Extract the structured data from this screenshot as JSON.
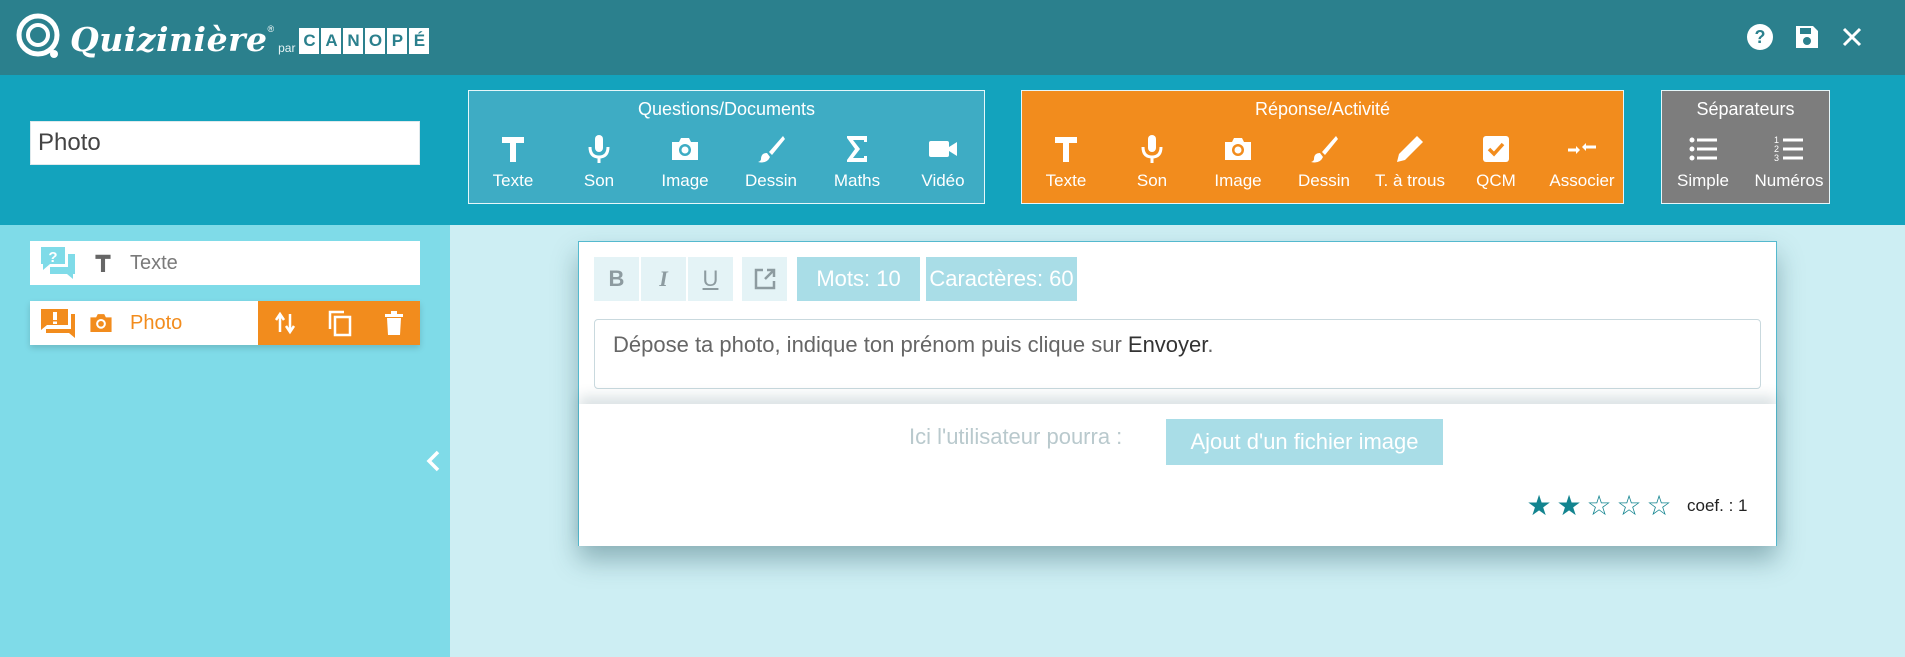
{
  "header": {
    "logo_word": "Quizinière",
    "logo_reg": "®",
    "logo_par": "par",
    "canope_letters": [
      "C",
      "A",
      "N",
      "O",
      "P",
      "É"
    ],
    "icons": [
      "help-icon",
      "save-icon",
      "close-icon"
    ]
  },
  "title_input": {
    "value": "Photo"
  },
  "questions": {
    "title": "Questions/Documents",
    "tools": [
      {
        "label": "Texte",
        "icon": "text-icon"
      },
      {
        "label": "Son",
        "icon": "microphone-icon"
      },
      {
        "label": "Image",
        "icon": "camera-icon"
      },
      {
        "label": "Dessin",
        "icon": "brush-icon"
      },
      {
        "label": "Maths",
        "icon": "sigma-icon"
      },
      {
        "label": "Vidéo",
        "icon": "video-icon"
      }
    ]
  },
  "reponse": {
    "title": "Réponse/Activité",
    "tools": [
      {
        "label": "Texte",
        "icon": "text-icon"
      },
      {
        "label": "Son",
        "icon": "microphone-icon"
      },
      {
        "label": "Image",
        "icon": "camera-icon"
      },
      {
        "label": "Dessin",
        "icon": "brush-icon"
      },
      {
        "label": "T. à trous",
        "icon": "pencil-icon"
      },
      {
        "label": "QCM",
        "icon": "checkbox-icon"
      },
      {
        "label": "Associer",
        "icon": "associate-icon"
      }
    ]
  },
  "separateurs": {
    "title": "Séparateurs",
    "tools": [
      {
        "label": "Simple",
        "icon": "list-icon"
      },
      {
        "label": "Numéros",
        "icon": "numbered-list-icon"
      }
    ]
  },
  "items": [
    {
      "label": "Texte",
      "type_icon": "text-icon",
      "category_icon": "question-bubble-icon"
    },
    {
      "label": "Photo",
      "type_icon": "camera-icon",
      "category_icon": "answer-bubble-icon"
    }
  ],
  "editor": {
    "stats": {
      "words": "Mots: 10",
      "chars": "Caractères: 60"
    },
    "text_before": "Dépose ta photo, indique ton prénom puis clique sur ",
    "text_bold": "Envoyer",
    "text_after": ".",
    "ici_label": "Ici l'utilisateur pourra :",
    "ajout_label": "Ajout d'un fichier image",
    "rating": 2,
    "rating_max": 5,
    "coef": "coef. : 1"
  },
  "colors": {
    "header": "#2b808d",
    "toolbar": "#13a3bd",
    "questions_group": "#3eacc4",
    "reponse_group": "#f28c1d",
    "separateurs_group": "#7d7d7d",
    "left_panel": "#7fdbe8",
    "editor_bg": "#cdeef3",
    "star": "#13848f"
  }
}
